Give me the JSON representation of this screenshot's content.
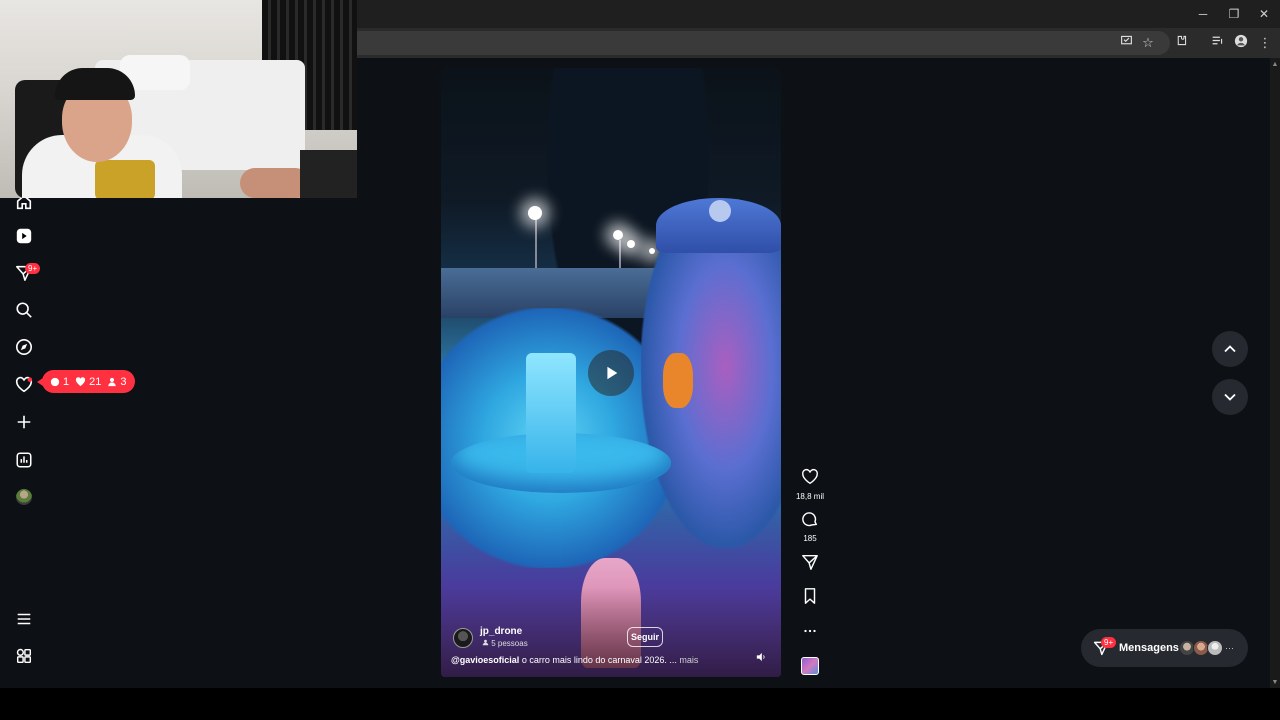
{
  "browser": {
    "window_controls": {
      "minimize": "─",
      "restore": "❐",
      "close": "✕"
    },
    "toolbar_icons": [
      "cast-icon",
      "star-icon",
      "extensions-icon",
      "media-icon",
      "profile-icon",
      "menu-icon"
    ]
  },
  "nav": {
    "notifications_badge": "9+",
    "activity_pill": {
      "comments": "1",
      "likes": "21",
      "followers": "3"
    }
  },
  "reel": {
    "author": "jp_drone",
    "audience": "5 pessoas",
    "follow_label": "Seguir",
    "caption_mention": "@gavioesoficial",
    "caption_text": " o carro mais lindo do carnaval 2026. ...",
    "caption_more": " mais"
  },
  "actions": {
    "likes": "18,8 mil",
    "comments": "185"
  },
  "messages": {
    "label": "Mensagens",
    "badge": "9+"
  },
  "colors": {
    "accent_red": "#ff3040",
    "page_bg": "#0d1014",
    "button_bg": "#262a30"
  }
}
